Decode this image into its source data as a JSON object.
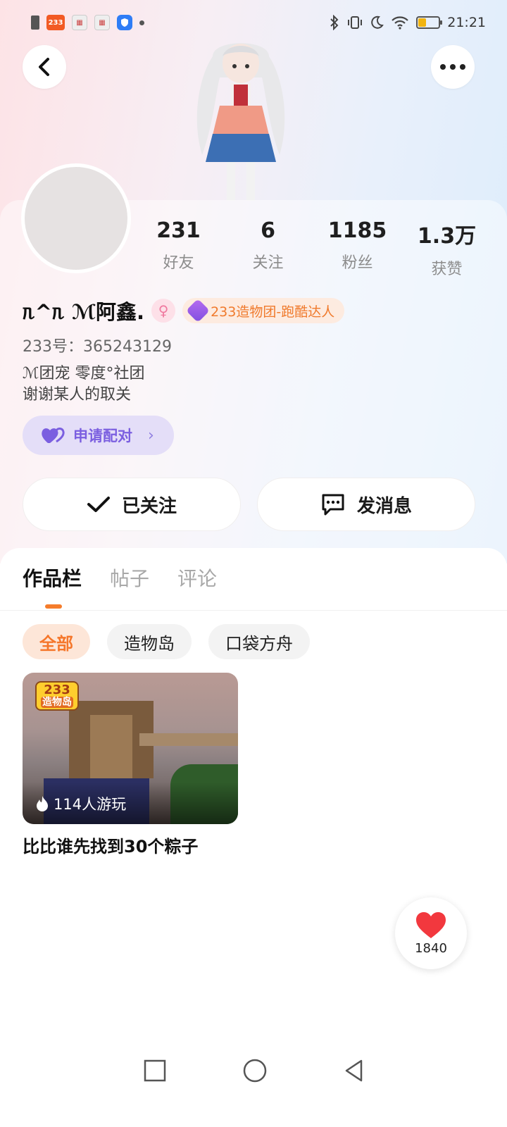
{
  "status_bar": {
    "app_icon_233": "233",
    "time": "21:21"
  },
  "profile": {
    "stats": [
      {
        "value": "231",
        "label": "好友"
      },
      {
        "value": "6",
        "label": "关注"
      },
      {
        "value": "1185",
        "label": "粉丝"
      },
      {
        "value": "1.3万",
        "label": "获赞"
      }
    ],
    "name": "ᥰ^ᥰ ℳ阿鑫.",
    "badge_text": "233造物团-跑酷达人",
    "uid": "233号：365243129",
    "bio_line1": "ℳ团宠  零度°社团",
    "bio_line2": "谢谢某人的取关",
    "pair_label": "申请配对",
    "follow_label": "已关注",
    "message_label": "发消息"
  },
  "tabs": [
    {
      "label": "作品栏",
      "active": true
    },
    {
      "label": "帖子",
      "active": false
    },
    {
      "label": "评论",
      "active": false
    }
  ],
  "chips": [
    {
      "label": "全部",
      "active": true
    },
    {
      "label": "造物岛",
      "active": false
    },
    {
      "label": "口袋方舟",
      "active": false
    }
  ],
  "works": [
    {
      "logo_top": "233",
      "logo_bottom": "造物岛",
      "plays": "114人游玩",
      "title": "比比谁先找到30个粽子"
    }
  ],
  "like_fab": {
    "count": "1840"
  },
  "colors": {
    "accent_orange": "#f5762a",
    "pair_purple": "#7b5fe0",
    "like_red": "#f2383e"
  }
}
